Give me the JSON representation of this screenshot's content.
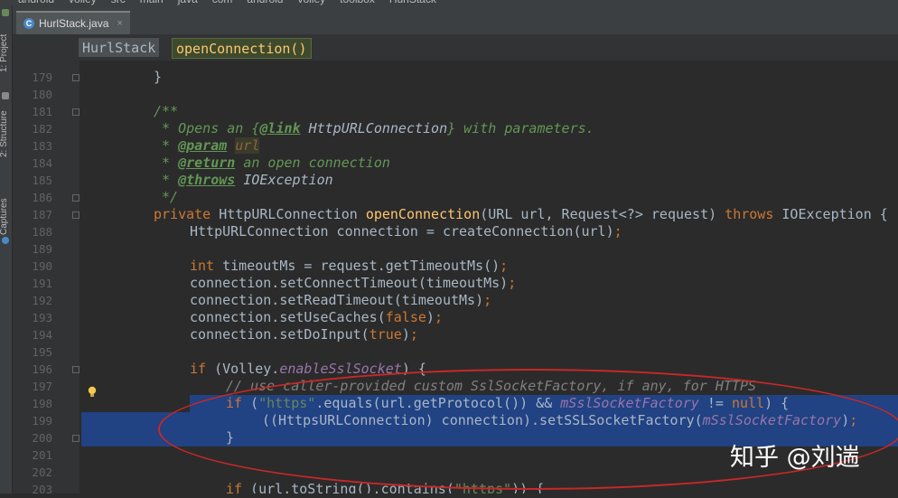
{
  "breadcrumbs": [
    "android",
    "volley",
    "src",
    "main",
    "java",
    "com",
    "android",
    "volley",
    "toolbox",
    "HurlStack"
  ],
  "sidebar": {
    "project_label": "1: Project",
    "structure_label": "2: Structure",
    "captures_label": "Captures"
  },
  "tab": {
    "filename": "HurlStack.java",
    "close_icon": "×",
    "file_icon_letter": "C"
  },
  "structure_breadcrumb": {
    "class_name": "HurlStack",
    "method_name": "openConnection()"
  },
  "colors": {
    "keyword": "#cc7832",
    "comment": "#629755",
    "method_decl": "#ffc66d",
    "string": "#6a8759",
    "field": "#9876aa",
    "line_comment": "#808080",
    "selection": "#214283",
    "plain": "#a9b7c6",
    "annotation_red": "#c82828"
  },
  "lines": [
    {
      "n": "179",
      "indent": 2,
      "tokens": [
        [
          "}",
          "p"
        ]
      ]
    },
    {
      "n": "180",
      "indent": 0,
      "tokens": []
    },
    {
      "n": "181",
      "indent": 2,
      "tokens": [
        [
          "/**",
          "c"
        ]
      ]
    },
    {
      "n": "182",
      "indent": 2,
      "tokens": [
        [
          " * Opens an {",
          "c"
        ],
        [
          "@link",
          "cb"
        ],
        [
          " HttpURLConnection",
          "ci"
        ],
        [
          "} with parameters.",
          "c"
        ]
      ]
    },
    {
      "n": "183",
      "indent": 2,
      "tokens": [
        [
          " * ",
          "c"
        ],
        [
          "@param",
          "cb"
        ],
        [
          " ",
          "c"
        ],
        [
          "url",
          "cv"
        ]
      ]
    },
    {
      "n": "184",
      "indent": 2,
      "tokens": [
        [
          " * ",
          "c"
        ],
        [
          "@return",
          "cb"
        ],
        [
          " an open connection",
          "c"
        ]
      ]
    },
    {
      "n": "185",
      "indent": 2,
      "tokens": [
        [
          " * ",
          "c"
        ],
        [
          "@throws",
          "cb"
        ],
        [
          " IOException",
          "ci"
        ]
      ]
    },
    {
      "n": "186",
      "indent": 2,
      "tokens": [
        [
          " */",
          "c"
        ]
      ]
    },
    {
      "n": "187",
      "indent": 2,
      "tokens": [
        [
          "private ",
          "k"
        ],
        [
          "HttpURLConnection ",
          "p"
        ],
        [
          "openConnection",
          "m"
        ],
        [
          "(URL url, Request<?> request) ",
          "p"
        ],
        [
          "throws ",
          "k"
        ],
        [
          "IOException {",
          "p"
        ]
      ]
    },
    {
      "n": "188",
      "indent": 4,
      "tokens": [
        [
          "HttpURLConnection connection = createConnection(url)",
          "p"
        ],
        [
          ";",
          "k"
        ]
      ]
    },
    {
      "n": "189",
      "indent": 0,
      "tokens": []
    },
    {
      "n": "190",
      "indent": 4,
      "tokens": [
        [
          "int ",
          "k"
        ],
        [
          "timeoutMs = request.getTimeoutMs()",
          "p"
        ],
        [
          ";",
          "k"
        ]
      ]
    },
    {
      "n": "191",
      "indent": 4,
      "tokens": [
        [
          "connection.setConnectTimeout(timeoutMs)",
          "p"
        ],
        [
          ";",
          "k"
        ]
      ]
    },
    {
      "n": "192",
      "indent": 4,
      "tokens": [
        [
          "connection.setReadTimeout(timeoutMs)",
          "p"
        ],
        [
          ";",
          "k"
        ]
      ]
    },
    {
      "n": "193",
      "indent": 4,
      "tokens": [
        [
          "connection.setUseCaches(",
          "p"
        ],
        [
          "false",
          "k"
        ],
        [
          ")",
          "p"
        ],
        [
          ";",
          "k"
        ]
      ]
    },
    {
      "n": "194",
      "indent": 4,
      "tokens": [
        [
          "connection.setDoInput(",
          "p"
        ],
        [
          "true",
          "k"
        ],
        [
          ")",
          "p"
        ],
        [
          ";",
          "k"
        ]
      ]
    },
    {
      "n": "195",
      "indent": 0,
      "tokens": []
    },
    {
      "n": "196",
      "indent": 4,
      "tokens": [
        [
          "if ",
          "k"
        ],
        [
          "(Volley.",
          "p"
        ],
        [
          "enableSslSocket",
          "f"
        ],
        [
          ") {",
          "p"
        ]
      ]
    },
    {
      "n": "197",
      "indent": 6,
      "tokens": [
        [
          "// use caller-provided custom SslSocketFactory, if any, for HTTPS",
          "g"
        ]
      ]
    },
    {
      "n": "198",
      "indent": 6,
      "tokens": [
        [
          "if ",
          "k"
        ],
        [
          "(",
          "p"
        ],
        [
          "\"https\"",
          "s"
        ],
        [
          ".equals(url.getProtocol()) && ",
          "p"
        ],
        [
          "mSslSocketFactory",
          "f"
        ],
        [
          " != ",
          "p"
        ],
        [
          "null",
          "k"
        ],
        [
          ") {",
          "p"
        ]
      ]
    },
    {
      "n": "199",
      "indent": 8,
      "tokens": [
        [
          "((HttpsURLConnection) connection).setSSLSocketFactory(",
          "p"
        ],
        [
          "mSslSocketFactory",
          "f"
        ],
        [
          ")",
          "p"
        ],
        [
          ";",
          "k"
        ]
      ]
    },
    {
      "n": "200",
      "indent": 6,
      "tokens": [
        [
          "}",
          "p"
        ]
      ]
    },
    {
      "n": "201",
      "indent": 0,
      "tokens": []
    },
    {
      "n": "202",
      "indent": 0,
      "tokens": []
    },
    {
      "n": "203",
      "indent": 6,
      "tokens": [
        [
          "if ",
          "k"
        ],
        [
          "(url.toString().contains(",
          "p"
        ],
        [
          "\"https\"",
          "s"
        ],
        [
          ")) {",
          "p"
        ]
      ]
    }
  ],
  "watermark": "知乎 @刘遄"
}
